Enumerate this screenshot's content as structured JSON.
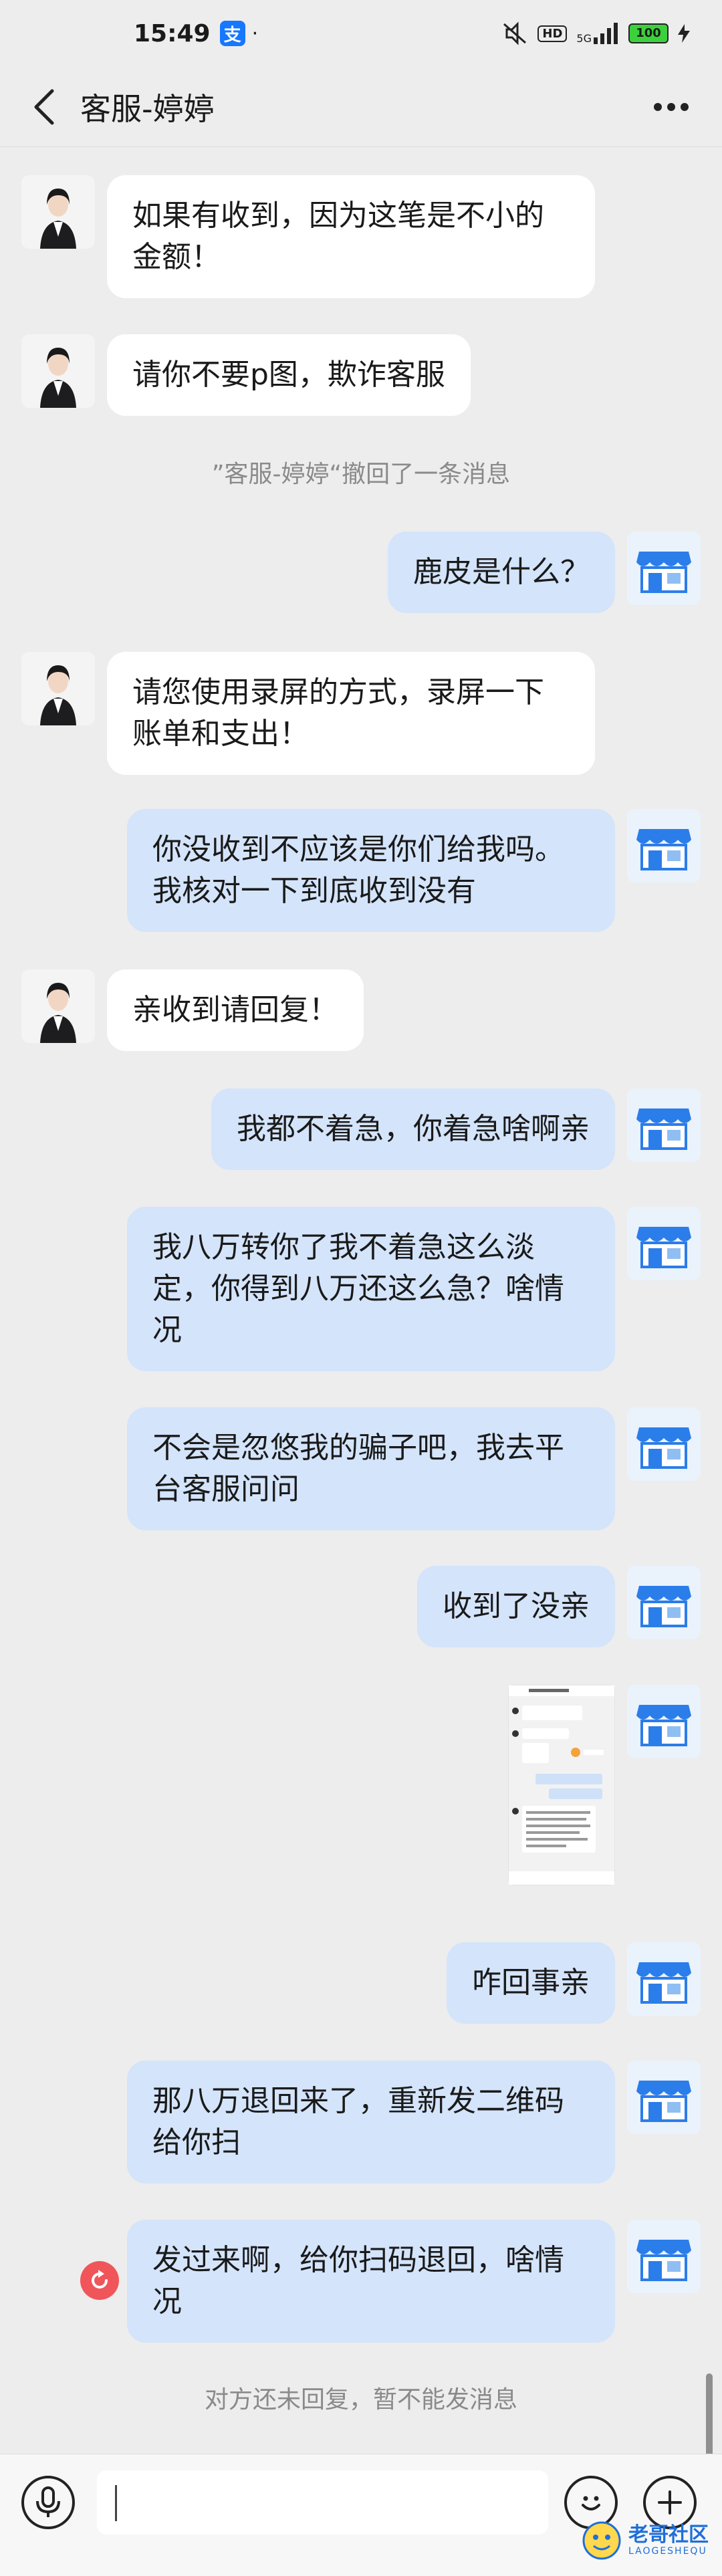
{
  "status_bar": {
    "time": "15:49",
    "alipay_badge": "支",
    "hd": "HD",
    "network": "5G",
    "battery": "100"
  },
  "header": {
    "title": "客服-婷婷"
  },
  "messages": [
    {
      "side": "left",
      "text": "如果有收到，因为这笔是不小的金额！"
    },
    {
      "side": "left",
      "text": "请你不要p图，欺诈客服"
    },
    {
      "side": "system",
      "text": "”客服-婷婷“撤回了一条消息"
    },
    {
      "side": "right",
      "text": "鹿皮是什么？"
    },
    {
      "side": "left",
      "text": "请您使用录屏的方式，录屏一下账单和支出！"
    },
    {
      "side": "right",
      "text": "你没收到不应该是你们给我吗。我核对一下到底收到没有"
    },
    {
      "side": "left",
      "text": "亲收到请回复！"
    },
    {
      "side": "right",
      "text": "我都不着急，你着急啥啊亲"
    },
    {
      "side": "right",
      "text": "我八万转你了我不着急这么淡定，你得到八万还这么急？啥情况"
    },
    {
      "side": "right",
      "text": "不会是忽悠我的骗子吧，我去平台客服问问"
    },
    {
      "side": "right",
      "text": "收到了没亲"
    },
    {
      "side": "right",
      "type": "image",
      "text": ""
    },
    {
      "side": "right",
      "text": "咋回事亲"
    },
    {
      "side": "right",
      "text": "那八万退回来了，重新发二维码给你扫"
    },
    {
      "side": "right",
      "text": "发过来啊，给你扫码退回，啥情况",
      "failed": true
    }
  ],
  "footer_notice": "对方还未回复，暂不能发消息",
  "input": {
    "value": ""
  },
  "watermark": {
    "title": "老哥社区",
    "sub": "LAOGESHEQU"
  },
  "colors": {
    "background": "#ededed",
    "bubble_self": "#d4e4fa",
    "bubble_other": "#ffffff",
    "error": "#f0555a"
  }
}
